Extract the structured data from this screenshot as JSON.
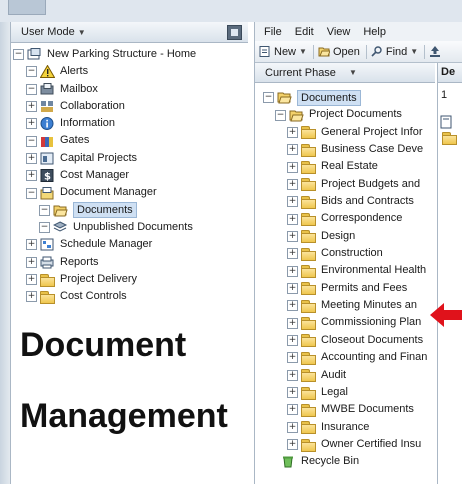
{
  "left_panel": {
    "header_label": "User Mode",
    "tree": [
      {
        "label": "New Parking Structure - Home",
        "icon": "project-icon",
        "exp": "⊟",
        "indent": 0
      },
      {
        "label": "Alerts",
        "icon": "alert-icon",
        "exp": "⊟",
        "indent": 1
      },
      {
        "label": "Mailbox",
        "icon": "mailbox-icon",
        "exp": "⊟",
        "indent": 1
      },
      {
        "label": "Collaboration",
        "icon": "collaboration-icon",
        "exp": "⊞",
        "indent": 1
      },
      {
        "label": "Information",
        "icon": "information-icon",
        "exp": "⊞",
        "indent": 1
      },
      {
        "label": "Gates",
        "icon": "gates-icon",
        "exp": "⊟",
        "indent": 1
      },
      {
        "label": "Capital Projects",
        "icon": "capital-projects-icon",
        "exp": "⊞",
        "indent": 1
      },
      {
        "label": "Cost Manager",
        "icon": "cost-manager-icon",
        "exp": "⊞",
        "indent": 1
      },
      {
        "label": "Document Manager",
        "icon": "document-manager-icon",
        "exp": "⊟",
        "indent": 1
      },
      {
        "label": "Documents",
        "icon": "folder-open-icon",
        "exp": "⊟",
        "indent": 2,
        "selected": true
      },
      {
        "label": "Unpublished Documents",
        "icon": "unpublished-icon",
        "exp": "⊟",
        "indent": 2
      },
      {
        "label": "Schedule Manager",
        "icon": "schedule-manager-icon",
        "exp": "⊞",
        "indent": 1
      },
      {
        "label": "Reports",
        "icon": "reports-icon",
        "exp": "⊞",
        "indent": 1
      },
      {
        "label": "Project Delivery",
        "icon": "folder-icon",
        "exp": "⊞",
        "indent": 1
      },
      {
        "label": "Cost Controls",
        "icon": "folder-icon",
        "exp": "⊞",
        "indent": 1
      }
    ]
  },
  "right_panel": {
    "menu": [
      "File",
      "Edit",
      "View",
      "Help"
    ],
    "toolbar": [
      {
        "label": "New",
        "icon": "new-icon",
        "dropdown": true
      },
      {
        "label": "Open",
        "icon": "open-icon",
        "dropdown": false
      },
      {
        "label": "Find",
        "icon": "find-icon",
        "dropdown": true
      }
    ],
    "phase_label": "Current Phase",
    "side_column": {
      "header": "De",
      "value": "1"
    },
    "tree": [
      {
        "label": "Documents",
        "exp": "⊟",
        "indent": 0,
        "selected": true,
        "open": true
      },
      {
        "label": "Project Documents",
        "exp": "⊟",
        "indent": 1,
        "open": true
      },
      {
        "label": "General Project Infor",
        "exp": "⊞",
        "indent": 2
      },
      {
        "label": "Business Case Deve",
        "exp": "⊞",
        "indent": 2
      },
      {
        "label": "Real Estate",
        "exp": "⊞",
        "indent": 2
      },
      {
        "label": "Project Budgets and",
        "exp": "⊞",
        "indent": 2
      },
      {
        "label": "Bids and Contracts",
        "exp": "⊞",
        "indent": 2
      },
      {
        "label": "Correspondence",
        "exp": "⊞",
        "indent": 2
      },
      {
        "label": "Design",
        "exp": "⊞",
        "indent": 2
      },
      {
        "label": "Construction",
        "exp": "⊞",
        "indent": 2
      },
      {
        "label": "Environmental Health",
        "exp": "⊞",
        "indent": 2
      },
      {
        "label": "Permits and Fees",
        "exp": "⊞",
        "indent": 2
      },
      {
        "label": "Meeting Minutes an",
        "exp": "⊞",
        "indent": 2
      },
      {
        "label": "Commissioning Plan",
        "exp": "⊞",
        "indent": 2
      },
      {
        "label": "Closeout Documents",
        "exp": "⊞",
        "indent": 2
      },
      {
        "label": "Accounting and Finan",
        "exp": "⊞",
        "indent": 2
      },
      {
        "label": "Audit",
        "exp": "⊞",
        "indent": 2
      },
      {
        "label": "Legal",
        "exp": "⊞",
        "indent": 2
      },
      {
        "label": "MWBE Documents",
        "exp": "⊞",
        "indent": 2
      },
      {
        "label": "Insurance",
        "exp": "⊞",
        "indent": 2
      },
      {
        "label": "Owner Certified Insu",
        "exp": "⊞",
        "indent": 2
      },
      {
        "label": "Recycle Bin",
        "exp": "",
        "indent": 1,
        "recycle": true
      }
    ]
  },
  "overlay": {
    "line1": "Document",
    "line2": "Management"
  },
  "colors": {
    "arrow": "#e0121b",
    "selection": "#cfe0f3",
    "folder": "#efc64e"
  }
}
